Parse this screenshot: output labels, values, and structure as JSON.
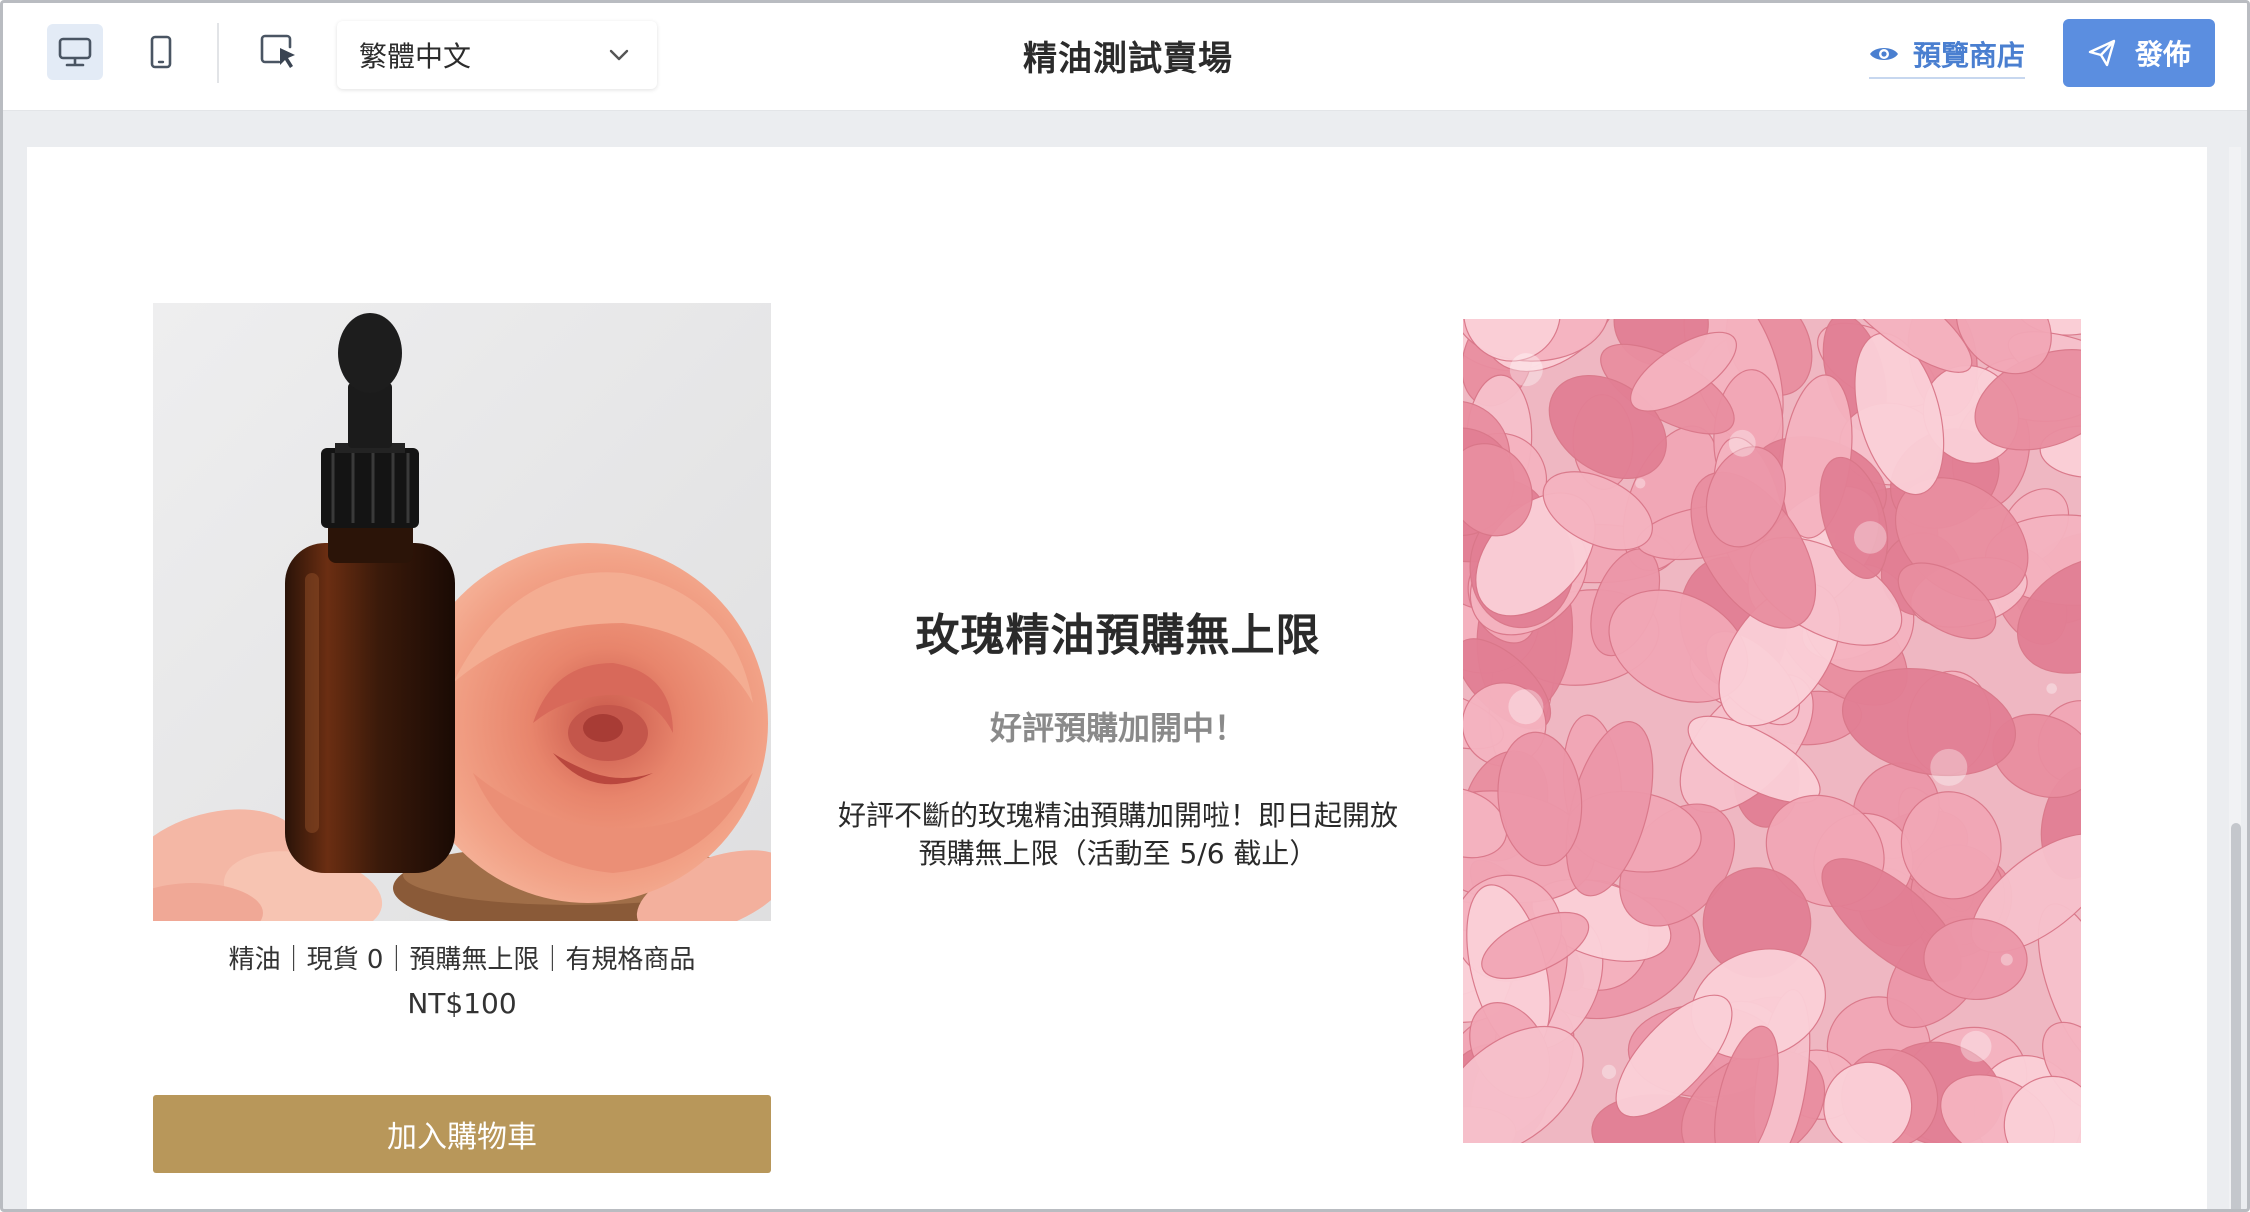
{
  "toolbar": {
    "devices": [
      {
        "name": "desktop-icon",
        "active": true
      },
      {
        "name": "mobile-icon",
        "active": false
      }
    ],
    "select_tool_icon": "cursor-select-icon",
    "language": {
      "selected": "繁體中文"
    },
    "title": "精油測試賣場",
    "preview_label": "預覽商店",
    "publish_label": "發佈"
  },
  "product": {
    "meta": "精油｜現貨 0｜預購無上限｜有規格商品",
    "price": "NT$100",
    "cart_label": "加入購物車"
  },
  "promo": {
    "title": "玫瑰精油預購無上限",
    "subtitle": "好評預購加開中！",
    "description": "好評不斷的玫瑰精油預購加開啦！即日起開放預購無上限（活動至 5/6 截止）"
  },
  "colors": {
    "accent": "#5b8ee0",
    "link": "#4a7fd0",
    "cart_button": "#b8975a"
  }
}
